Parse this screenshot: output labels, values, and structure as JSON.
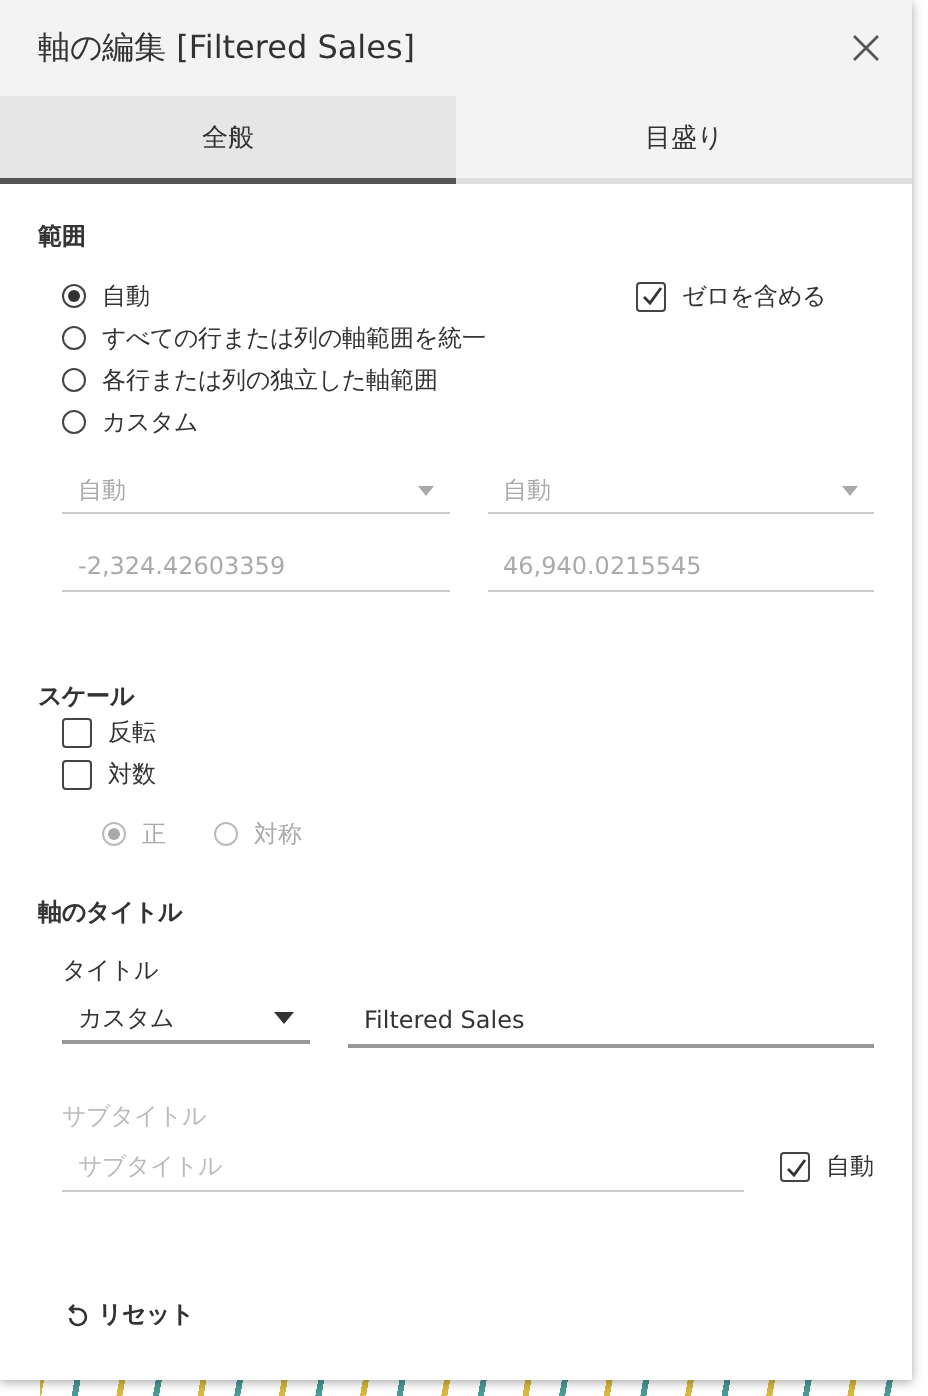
{
  "window": {
    "title": "軸の編集 [Filtered Sales]"
  },
  "tabs": [
    {
      "label": "全般",
      "selected": true
    },
    {
      "label": "目盛り",
      "selected": false
    }
  ],
  "range": {
    "heading": "範囲",
    "options": [
      {
        "label": "自動",
        "selected": true
      },
      {
        "label": "すべての行または列の軸範囲を統一",
        "selected": false
      },
      {
        "label": "各行または列の独立した軸範囲",
        "selected": false
      },
      {
        "label": "カスタム",
        "selected": false
      }
    ],
    "include_zero": {
      "label": "ゼロを含める",
      "checked": true
    },
    "start": {
      "mode": "自動",
      "value": "-2,324.42603359",
      "disabled": true
    },
    "end": {
      "mode": "自動",
      "value": "46,940.0215545",
      "disabled": true
    }
  },
  "scale": {
    "heading": "スケール",
    "checkboxes": [
      {
        "label": "反転",
        "checked": false
      },
      {
        "label": "対数",
        "checked": false
      }
    ],
    "log_options": [
      {
        "label": "正",
        "selected": true,
        "disabled": true
      },
      {
        "label": "対称",
        "selected": false,
        "disabled": true
      }
    ]
  },
  "axis_title": {
    "heading": "軸のタイトル",
    "title_label": "タイトル",
    "title_mode": "カスタム",
    "title_value": "Filtered Sales",
    "subtitle_label": "サブタイトル",
    "subtitle_placeholder": "サブタイトル",
    "subtitle_disabled": true,
    "subtitle_auto": {
      "label": "自動",
      "checked": true
    }
  },
  "reset": {
    "label": "リセット"
  }
}
